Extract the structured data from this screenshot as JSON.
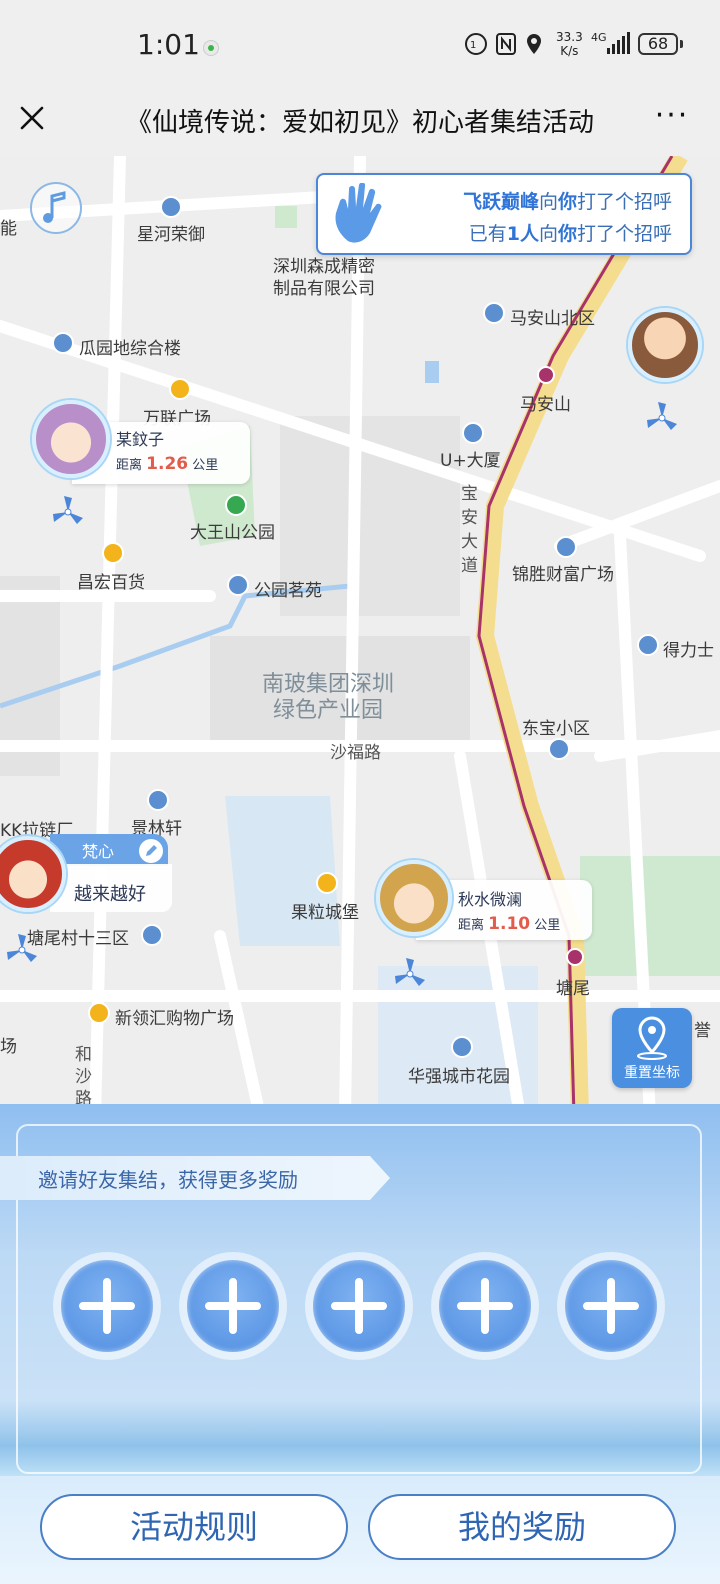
{
  "status_bar": {
    "time": "1:01",
    "net_speed_top": "33.3",
    "net_speed_bottom": "K/s",
    "net_type": "4G",
    "battery": "68"
  },
  "title_bar": {
    "title": "《仙境传说：爱如初见》初心者集结活动",
    "more": "···"
  },
  "map": {
    "labels": {
      "left_edge_top": "能",
      "xinghe": "星河荣御",
      "senyuan_1": "深圳森成精密",
      "senyuan_2": "制品有限公司",
      "maanshan_north": "马安山北区",
      "guayuan": "瓜园地综合楼",
      "wanlian": "万联广场",
      "maanshan": "马安山",
      "uplus": "U+大厦",
      "baoan_road": "宝安大道",
      "dawangshan": "大王山公园",
      "changhong": "昌宏百货",
      "jinsheng": "锦胜财富广场",
      "gongyuan": "公园茗苑",
      "deli": "得力士",
      "nanbo_1": "南玻集团深圳",
      "nanbo_2": "绿色产业园",
      "dongbao": "东宝小区",
      "shafu_road": "沙福路",
      "kk": "KK拉链厂",
      "jinglin": "景林轩",
      "guoli": "果粒城堡",
      "tangwei_13": "塘尾村十三区",
      "tangwei": "塘尾",
      "xinling": "新领汇购物广场",
      "huaqiang": "华强城市花园",
      "heshalu_1": "和",
      "heshalu_2": "沙",
      "heshalu_3": "路",
      "left_edge_bottom": "场",
      "right_edge": "誉"
    },
    "greeting": {
      "from_name": "飞跃巅峰",
      "line1_mid": "向",
      "line1_you": "你",
      "line1_end": "打了个招呼",
      "line2_start": "已有",
      "line2_count": "1人",
      "line2_mid": "向",
      "line2_you": "你",
      "line2_end": "打了个招呼"
    },
    "players": [
      {
        "name": "某鈫子",
        "dist_prefix": "距离",
        "dist_value": "1.26",
        "dist_unit": "公里"
      },
      {
        "name": "秋水微澜",
        "dist_prefix": "距离",
        "dist_value": "1.10",
        "dist_unit": "公里"
      },
      {
        "name": "梵心",
        "message": "越来越好"
      }
    ],
    "reset_button": "重置坐标"
  },
  "panel": {
    "invite_text": "邀请好友集结，获得更多奖励",
    "slots": 5
  },
  "buttons": {
    "rules": "活动规则",
    "rewards": "我的奖励"
  },
  "colors": {
    "accent": "#4b8fe0",
    "distance_value": "#e35b4a",
    "highlight": "#2f74d6"
  }
}
